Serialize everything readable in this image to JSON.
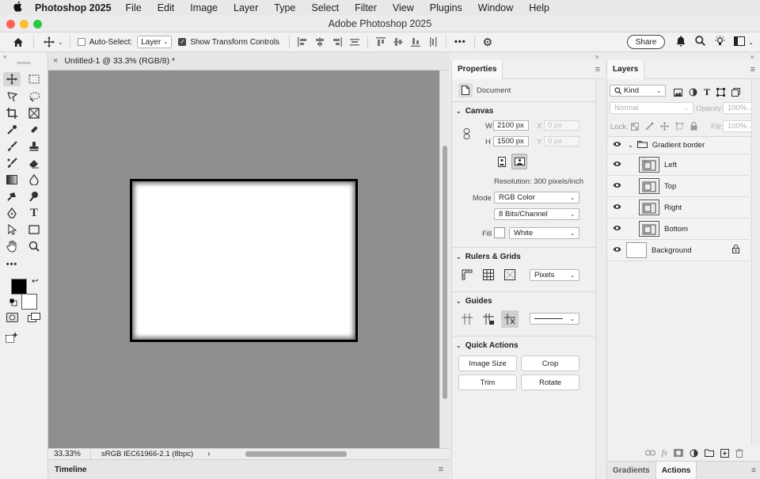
{
  "menubar": {
    "app_name": "Photoshop 2025",
    "items": [
      "File",
      "Edit",
      "Image",
      "Layer",
      "Type",
      "Select",
      "Filter",
      "View",
      "Plugins",
      "Window",
      "Help"
    ]
  },
  "window": {
    "title": "Adobe Photoshop 2025"
  },
  "options_bar": {
    "auto_select_label": "Auto-Select:",
    "auto_select_checked": false,
    "auto_select_value": "Layer",
    "show_transform_label": "Show Transform Controls",
    "show_transform_checked": true,
    "share_label": "Share",
    "more_label": "•••"
  },
  "document": {
    "tab_title": "Untitled-1 @ 33.3% (RGB/8) *",
    "close_glyph": "×",
    "zoom": "33.33%",
    "color_profile": "sRGB IEC61966-2.1 (8bpc)",
    "status_arrow": "›"
  },
  "timeline": {
    "label": "Timeline"
  },
  "properties": {
    "tab_label": "Properties",
    "doc_label": "Document",
    "canvas": {
      "title": "Canvas",
      "w_label": "W",
      "w_value": "2100 px",
      "h_label": "H",
      "h_value": "1500 px",
      "x_label": "X",
      "x_placeholder": "0 px",
      "y_label": "Y",
      "y_placeholder": "0 px",
      "resolution": "Resolution: 300 pixels/inch",
      "mode_label": "Mode",
      "mode_value": "RGB Color",
      "bits_value": "8 Bits/Channel",
      "fill_label": "Fill",
      "fill_value": "White"
    },
    "rulers": {
      "title": "Rulers & Grids",
      "units_value": "Pixels"
    },
    "guides": {
      "title": "Guides"
    },
    "quick_actions": {
      "title": "Quick Actions",
      "buttons": [
        "Image Size",
        "Crop",
        "Trim",
        "Rotate"
      ]
    }
  },
  "layers": {
    "tab_label": "Layers",
    "filter_value": "Kind",
    "blend_mode": "Normal",
    "opacity_label": "Opacity:",
    "opacity_value": "100%",
    "lock_label": "Lock:",
    "fill_label": "Fill:",
    "fill_value": "100%",
    "items": [
      {
        "name": "Gradient border",
        "type": "group"
      },
      {
        "name": "Left",
        "type": "layer"
      },
      {
        "name": "Top",
        "type": "layer"
      },
      {
        "name": "Right",
        "type": "layer"
      },
      {
        "name": "Bottom",
        "type": "layer"
      },
      {
        "name": "Background",
        "type": "background",
        "locked": true
      }
    ],
    "bottom_tabs": [
      "Gradients",
      "Actions"
    ],
    "active_bottom_tab": "Actions"
  },
  "colors": {
    "foreground": "#000000",
    "background": "#ffffff",
    "canvas_bg": "#8f8f8f"
  }
}
